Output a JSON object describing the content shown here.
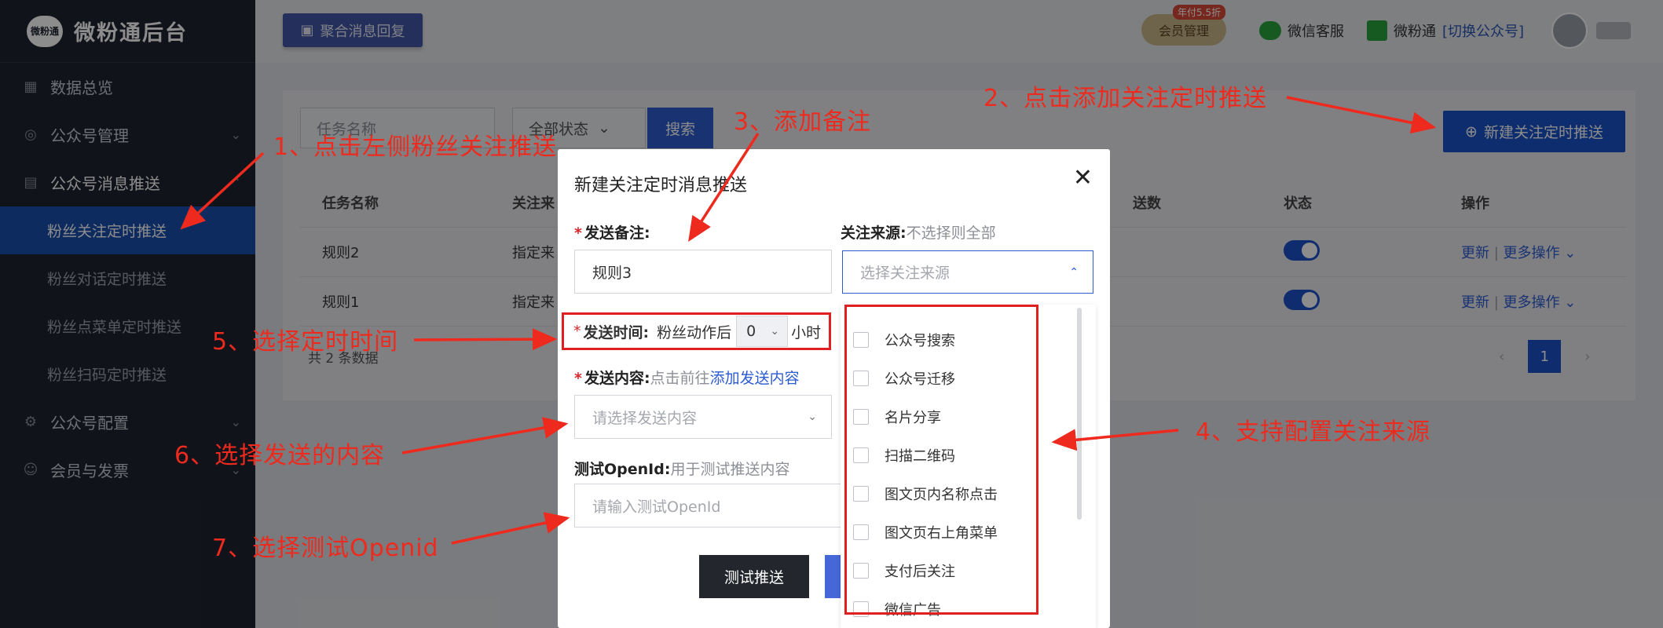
{
  "app": {
    "logo_badge": "微粉通",
    "logo_text": "微粉通后台"
  },
  "sidebar": {
    "items": [
      {
        "label": "数据总览",
        "icon": "chart-icon"
      },
      {
        "label": "公众号管理",
        "icon": "account-icon"
      },
      {
        "label": "公众号消息推送",
        "icon": "message-icon"
      },
      {
        "label": "粉丝关注定时推送",
        "active": true
      },
      {
        "label": "粉丝对话定时推送"
      },
      {
        "label": "粉丝点菜单定时推送"
      },
      {
        "label": "粉丝扫码定时推送"
      },
      {
        "label": "公众号配置",
        "icon": "gear-icon"
      },
      {
        "label": "会员与发票",
        "icon": "user-icon"
      }
    ]
  },
  "header": {
    "merge_reply": "聚合消息回复",
    "vip_label": "会员管理",
    "vip_tag": "年付5.5折",
    "service": "微信客服",
    "account_name": "微粉通",
    "account_switch": "[切换公众号]"
  },
  "filter": {
    "name_placeholder": "任务名称",
    "status_value": "全部状态",
    "search_label": "搜索",
    "new_button": "新建关注定时推送"
  },
  "table": {
    "headers": [
      "任务名称",
      "关注来",
      "送数",
      "状态",
      "操作"
    ],
    "rows": [
      {
        "name": "规则2",
        "source": "指定来",
        "update": "更新",
        "more": "更多操作"
      },
      {
        "name": "规则1",
        "source": "指定来",
        "update": "更新",
        "more": "更多操作"
      }
    ],
    "total": "共 2 条数据",
    "page": "1"
  },
  "modal": {
    "title": "新建关注定时消息推送",
    "remark_label": "发送备注:",
    "remark_value": "规则3",
    "source_label": "关注来源:",
    "source_hint": "不选择则全部",
    "source_placeholder": "选择关注来源",
    "time_label": "发送时间:",
    "time_prefix": "粉丝动作后",
    "time_value": "0",
    "time_unit": "小时",
    "content_label": "发送内容:",
    "content_hint": "点击前往",
    "content_link": "添加发送内容",
    "content_placeholder": "请选择发送内容",
    "openid_label": "测试OpenId:",
    "openid_hint": "用于测试推送内容",
    "openid_placeholder": "请输入测试OpenId",
    "test_button": "测试推送"
  },
  "dropdown": {
    "options": [
      "公众号搜索",
      "公众号迁移",
      "名片分享",
      "扫描二维码",
      "图文页内名称点击",
      "图文页右上角菜单",
      "支付后关注",
      "微信广告"
    ]
  },
  "annotations": {
    "a1": "1、点击左侧粉丝关注推送",
    "a2": "2、点击添加关注定时推送",
    "a3": "3、添加备注",
    "a4": "4、支持配置关注来源",
    "a5": "5、选择定时时间",
    "a6": "6、选择发送的内容",
    "a7": "7、选择测试Openid"
  },
  "colors": {
    "sidebar_bg": "#1f2432",
    "accent": "#1a52c9",
    "annotation": "#ee2a1e"
  }
}
